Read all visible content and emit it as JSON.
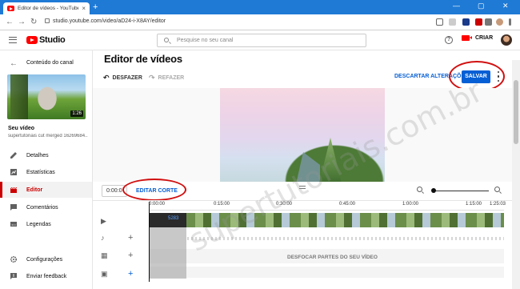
{
  "browser": {
    "tab_title": "Editor de vídeos - YouTube Studi",
    "tab_close": "×",
    "newtab": "+",
    "url": "studio.youtube.com/video/aD24-i-X8AY/editor",
    "back_glyph": "←",
    "fwd_glyph": "→",
    "reload_glyph": "↻",
    "min": "—",
    "max": "▢",
    "close": "✕"
  },
  "header": {
    "logo": "Studio",
    "search_placeholder": "Pesquise no seu canal",
    "help": "?",
    "create_label": "CRIAR"
  },
  "sidebar": {
    "back_glyph": "←",
    "channel_content": "Conteúdo do canal",
    "duration": "1:26",
    "your_video": "Seu vídeo",
    "video_title": "supertutoriais cut merged 16269684...",
    "items": [
      {
        "label": "Detalhes",
        "icon": "pencil-icon"
      },
      {
        "label": "Estatísticas",
        "icon": "analytics-icon"
      },
      {
        "label": "Editor",
        "icon": "clapper-icon"
      },
      {
        "label": "Comentários",
        "icon": "comment-icon"
      },
      {
        "label": "Legendas",
        "icon": "subtitles-icon"
      }
    ],
    "bottom_items": [
      {
        "label": "Configurações",
        "icon": "gear-icon"
      },
      {
        "label": "Enviar feedback",
        "icon": "feedback-icon"
      }
    ]
  },
  "editor": {
    "title": "Editor de vídeos",
    "undo": "DESFAZER",
    "redo": "REFAZER",
    "discard": "DESCARTAR ALTERAÇÕES",
    "save": "SALVAR",
    "time": "0:00:0",
    "trim": "EDITAR CORTE",
    "handle": "="
  },
  "timeline": {
    "ticks": [
      "0:00:00",
      "0:15:00",
      "0:30:00",
      "0:45:00",
      "1:00:00",
      "1:15:00",
      "1:25:03"
    ],
    "blur_label": "DESFOCAR PARTES DO SEU VÍDEO",
    "track_icons": [
      "▶",
      "♪",
      "▦",
      "▣"
    ],
    "plus": "+",
    "thumb_label": "5283"
  },
  "watermark": "supertutoriais.com.br",
  "colors": {
    "accent": "#065fd4",
    "brand": "#ff0000",
    "active_nav": "#cc0000",
    "annotation": "#d10f0f"
  }
}
